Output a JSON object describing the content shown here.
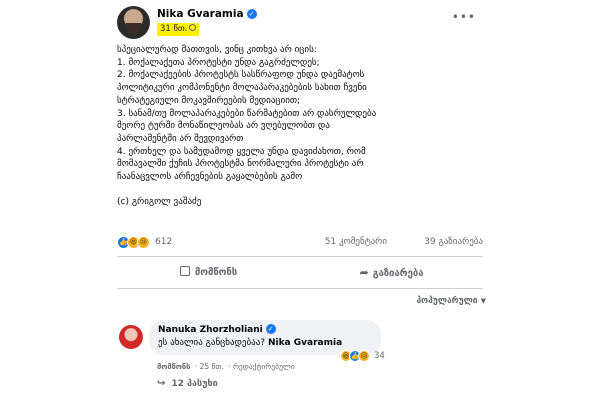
{
  "post": {
    "author": "Nika Gvaramia",
    "time": "31 წთ.",
    "body_lines": [
      "სპეციალურად მათთვის, ვინც კითხვა არ იცის:",
      " 1. მოქალაქეთა პროტესტი უნდა გაგრძელდეს;",
      " 2. მოქალაქეების პროტესტს სასწრაფოდ უნდა დაემატოს",
      "პოლიტიკური კომპონენტი მოლაპარაკებების სახით ჩვენი",
      "სტრატეგიული მოკავშირეების მედიაციით;",
      " 3. სანამ/თუ მოლაპარაკებები წარმატებით არ დასრულდება",
      "მეორე ტურში მონაწილეობას არ ვღებულობთ და",
      "პარლამენტში არ შევდივართ",
      " 4. ერთხელ და სამუდამოდ ყველა უნდა დავიძახოთ, რომ",
      "მომავალში ქუჩის პროტესტმა ნორმალური პროტესტი არ",
      "ჩაანაცვლოს არჩევნების გაყალბების გამო",
      "",
      "(c) გრიგოლ ვაშაძე"
    ],
    "reactions_count": "612",
    "comments_count": "51 კომენტარი",
    "shares_count": "39 გაზიარება"
  },
  "actions": {
    "like": "მომწონს",
    "share": "გაზიარება"
  },
  "sort_label": "პოპულარული",
  "comment": {
    "author": "Nanuka Zhorzholiani",
    "text": "ეს ახალია განცხადებაა?",
    "mention": "Nika Gvaramia",
    "reactions_count": "34",
    "like_label": "მომწონს",
    "time": "· 25 წთ.",
    "edited": "· რედაქტირებული"
  },
  "replies_label": "12 პასუხი",
  "icons": {
    "verified": "verified-check-icon",
    "globe": "globe-icon",
    "more": "more-options-icon",
    "like": "thumbs-up-icon",
    "share": "share-arrow-icon",
    "reply": "reply-arrow-icon"
  },
  "colors": {
    "accent": "#1877f2",
    "time_highlight": "#fff200",
    "secondary_text": "#65676b",
    "bubble": "#f0f2f5"
  }
}
